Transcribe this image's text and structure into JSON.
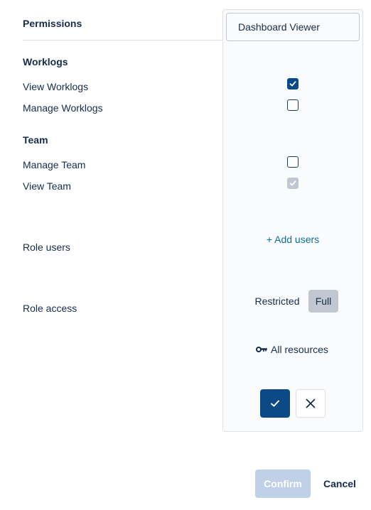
{
  "permissions_header": "Permissions",
  "sections": [
    {
      "title": "Worklogs",
      "items": [
        {
          "label": "View Worklogs",
          "state": "checked"
        },
        {
          "label": "Manage Worklogs",
          "state": "unchecked"
        }
      ]
    },
    {
      "title": "Team",
      "items": [
        {
          "label": "Manage Team",
          "state": "unchecked"
        },
        {
          "label": "View Team",
          "state": "checked-disabled"
        }
      ]
    }
  ],
  "role_users_label": "Role users",
  "role_access_label": "Role access",
  "panel": {
    "role_name_value": "Dashboard Viewer",
    "add_users_link": "+ Add users",
    "access_options": [
      "Restricted",
      "Full"
    ],
    "access_selected": "Full",
    "resources_icon": "key-icon",
    "resources_label": "All resources",
    "save_icon": "check-icon",
    "discard_icon": "close-icon"
  },
  "footer": {
    "confirm_label": "Confirm",
    "confirm_enabled": false,
    "cancel_label": "Cancel"
  },
  "colors": {
    "primary": "#0c4a87",
    "link": "#0b6e99",
    "text": "#172b4d",
    "disabled_button": "#c0d0e6",
    "selected_segment": "#c1c7d0"
  }
}
